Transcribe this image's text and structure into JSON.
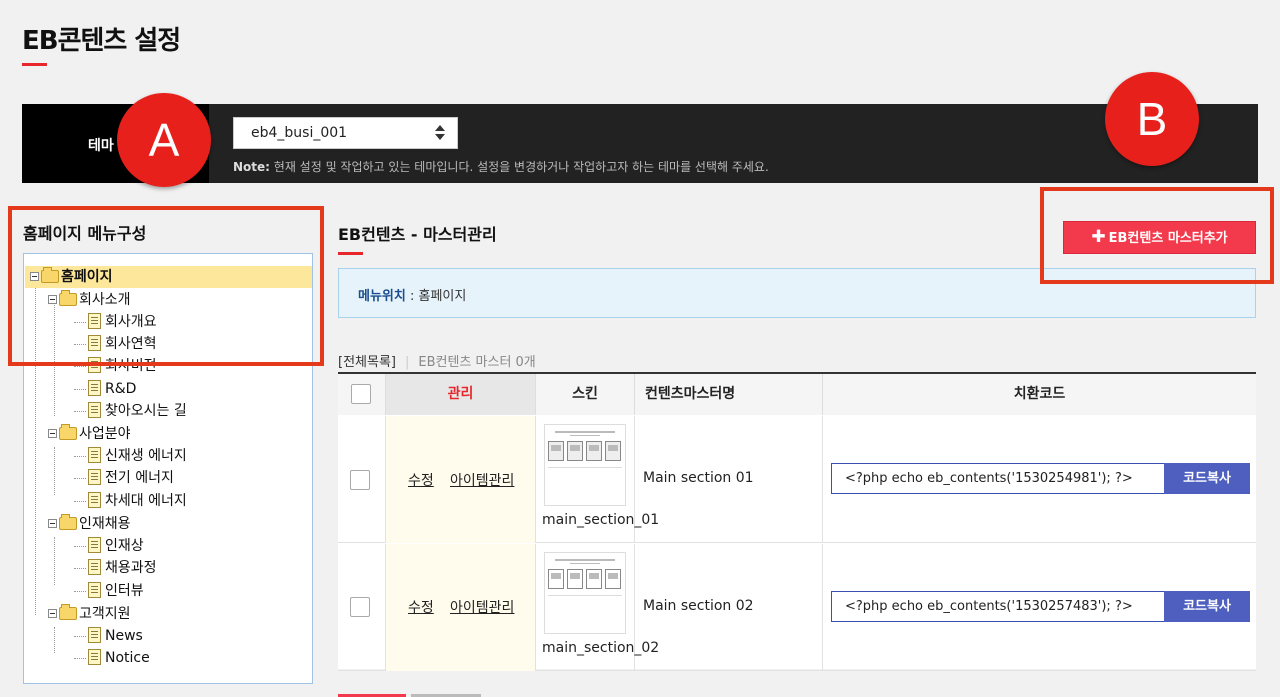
{
  "page": {
    "title": "EB콘텐츠 설정"
  },
  "theme": {
    "label": "테마",
    "selected": "eb4_busi_001",
    "note_label": "Note:",
    "note_text": " 현재 설정 및 작업하고 있는 테마입니다. 설정을 변경하거나 작업하고자 하는 테마를 선택해 주세요."
  },
  "annotations": {
    "a": "A",
    "b": "B"
  },
  "tree": {
    "title": "홈페이지 메뉴구성",
    "root": "홈페이지",
    "groups": [
      {
        "label": "회사소개",
        "items": [
          "회사개요",
          "회사연혁",
          "회사비전",
          "R&D",
          "찾아오시는 길"
        ]
      },
      {
        "label": "사업분야",
        "items": [
          "신재생 에너지",
          "전기 에너지",
          "차세대 에너지"
        ]
      },
      {
        "label": "인재채용",
        "items": [
          "인재상",
          "채용과정",
          "인터뷰"
        ]
      },
      {
        "label": "고객지원",
        "items": [
          "News",
          "Notice"
        ]
      }
    ]
  },
  "main": {
    "section_title": "EB컨텐츠 - 마스터관리",
    "add_button": "EB컨텐츠 마스터추가",
    "menu_location_label": "메뉴위치",
    "menu_location_value": " : 홈페이지",
    "list_all": "[전체목록]",
    "list_count": "EB컨텐츠 마스터 0개",
    "columns": [
      "관리",
      "스킨",
      "컨텐츠마스터명",
      "치환코드"
    ],
    "rows": [
      {
        "edit": "수정",
        "items": "아이템관리",
        "skin": "main_section_01",
        "name": "Main section 01",
        "code": "<?php echo eb_contents('1530254981'); ?>",
        "copy": "코드복사"
      },
      {
        "edit": "수정",
        "items": "아이템관리",
        "skin": "main_section_02",
        "name": "Main section 02",
        "code": "<?php echo eb_contents('1530257483'); ?>",
        "copy": "코드복사"
      }
    ]
  },
  "colors": {
    "accent": "#e8272c",
    "add_button": "#f23a4c",
    "copy_button": "#4f5fc0",
    "highlight": "#e43a1b"
  },
  "icons": [
    "folder-icon",
    "document-icon",
    "tree-toggle-icon",
    "plus-icon",
    "select-arrows-icon"
  ]
}
